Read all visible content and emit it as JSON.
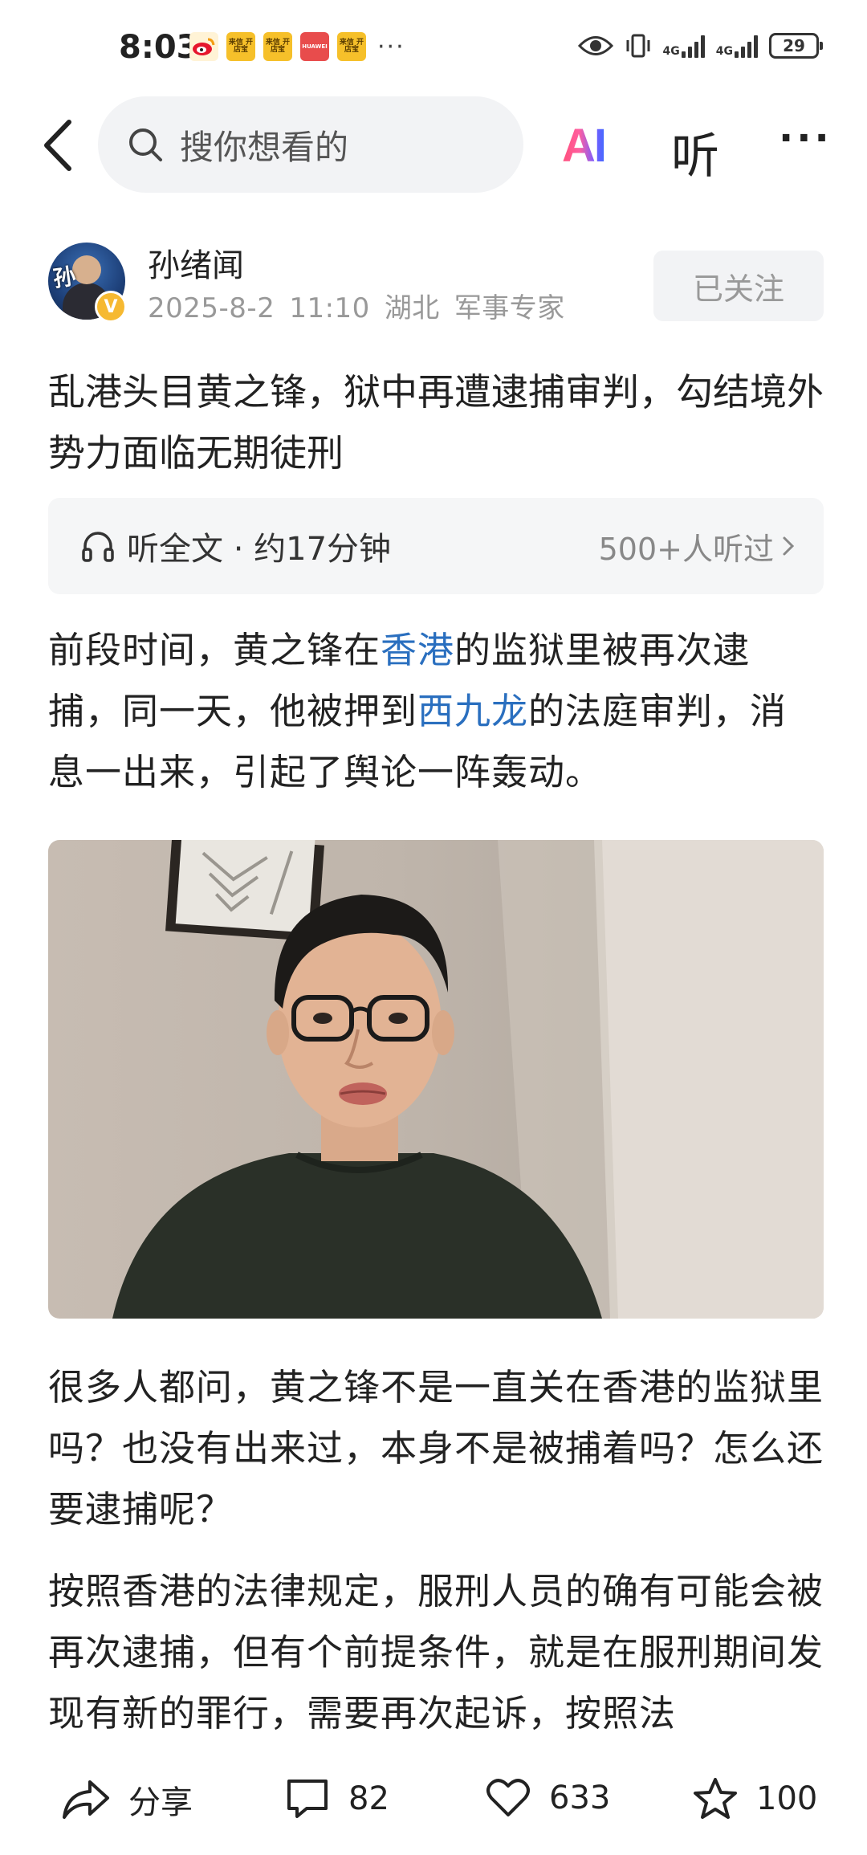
{
  "status_bar": {
    "time": "8:03",
    "app_icons": [
      "weibo-icon",
      "app-store-icon",
      "app-store-icon",
      "huawei-icon",
      "app-store-icon"
    ],
    "app_chip_labels": [
      "",
      "来信\n开店宝",
      "来信\n开店宝",
      "HUAWEI",
      "来信\n开店宝"
    ],
    "more": "···",
    "network_1": "4G",
    "network_2": "4G",
    "battery": "29"
  },
  "nav": {
    "search_placeholder": "搜你想看的",
    "ai_label": "AI",
    "listen_label": "听",
    "more_label": "···"
  },
  "author": {
    "name": "孙绪闻",
    "date": "2025-8-2",
    "time": "11:10",
    "location": "湖北",
    "tag": "军事专家",
    "follow_label": "已关注",
    "avatar_text": "孙",
    "verified_mark": "V"
  },
  "article": {
    "title": "乱港头目黄之锋，狱中再遭逮捕审判，勾结境外势力面临无期徒刑",
    "listen_bar": {
      "left_label": "听全文 · 约17分钟",
      "right_label": "500+人听过"
    },
    "para1": {
      "t1": "前段时间，黄之锋在",
      "link1": "香港",
      "t2": "的监狱里被再次逮捕，同一天，他被押到",
      "link2": "西九龙",
      "t3": "的法庭审判，消息一出来，引起了舆论一阵轰动。"
    },
    "para2": "很多人都问，黄之锋不是一直关在香港的监狱里吗？也没有出来过，本身不是被捕着吗？怎么还要逮捕呢？",
    "para3": "按照香港的法律规定，服刑人员的确有可能会被再次逮捕，但有个前提条件，就是在服刑期间发现有新的罪行，需要再次起诉，按照法"
  },
  "bottom_bar": {
    "share_label": "分享",
    "comments": "82",
    "likes": "633",
    "favorites": "100"
  },
  "colors": {
    "link": "#2a6fbf",
    "muted": "#999999",
    "text": "#222222",
    "badge": "#f6b931"
  }
}
